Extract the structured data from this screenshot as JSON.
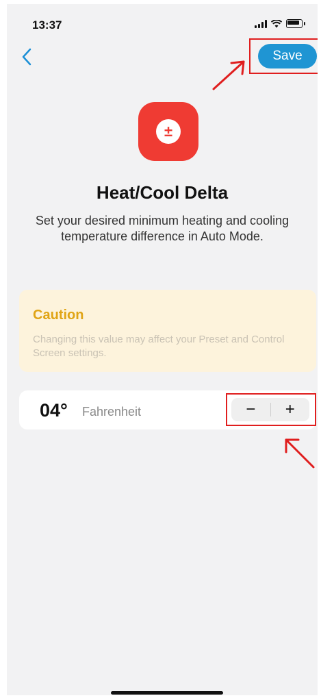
{
  "status_bar": {
    "time": "13:37"
  },
  "nav": {
    "save_label": "Save"
  },
  "header": {
    "icon_glyph": "±",
    "title": "Heat/Cool Delta",
    "subtitle": "Set your desired minimum heating and cooling temperature difference in Auto Mode."
  },
  "caution": {
    "title": "Caution",
    "text": "Changing this value may affect your Preset and Control Screen settings."
  },
  "setting": {
    "value": "04°",
    "unit": "Fahrenheit",
    "decrement_label": "−",
    "increment_label": "+"
  },
  "colors": {
    "accent": "#1f95d3",
    "icon_bg": "#ef3b33",
    "caution_title": "#e0a415",
    "annotation": "#e01e1e"
  }
}
